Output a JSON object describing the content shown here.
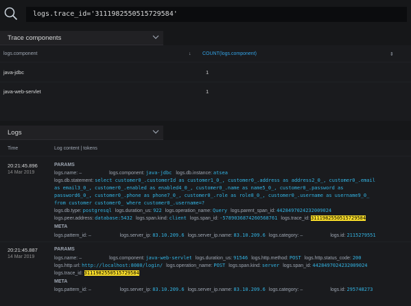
{
  "query": {
    "prefix": "logs.",
    "field": "trace_id",
    "op": "=",
    "value": "'3111982550515729584'"
  },
  "trace_panel": {
    "title": "Trace components",
    "col_component": "logs.component",
    "col_count": "COUNT(logs.component)",
    "rows": [
      {
        "component": "java-jdbc",
        "count": "1"
      },
      {
        "component": "java-web-servlet",
        "count": "1"
      }
    ]
  },
  "logs_panel": {
    "title": "Logs",
    "col_time": "Time",
    "col_content": "Log content | tokens",
    "entries": [
      {
        "time": "20:21:45.896",
        "date": "14 Mar 2019",
        "params_label": "PARAMS",
        "meta_label": "META",
        "l1": {
          "name_k": "logs.name:",
          "name_v": "–",
          "comp_k": "logs.component:",
          "comp_v": "java-jdbc",
          "inst_k": "logs.db.instance:",
          "inst_v": "atsea"
        },
        "l2": {
          "stmt_k": "logs.db.statement:",
          "stmt_v": "select customer0_.customerId as customer1_0_, customer0_.address as address2_0_, customer0_.email"
        },
        "l3": "as email3_0_, customer0_.enabled as enabled4_0_, customer0_.name as name5_0_, customer0_.password as",
        "l4": "password6_0_, customer0_.phone as phone7_0_, customer0_.role as role8_0_, customer0_.username as username9_0_",
        "l5": "from customer customer0_ where customer0_.username=?",
        "l6": {
          "type_k": "logs.db.type:",
          "type_v": "postgresql",
          "dur_k": "logs.duration_us:",
          "dur_v": "922",
          "op_k": "logs.operation_name:",
          "op_v": "Query",
          "parent_k": "logs.parent_span_id:",
          "parent_v": "4428497024232009024"
        },
        "l7": {
          "peer_k": "logs.peer.address:",
          "peer_v": "database:5432",
          "kind_k": "logs.span.kind:",
          "kind_v": "client",
          "span_k": "logs.span_id:",
          "span_v": "-5789036874260568761",
          "trace_k": "logs.trace_id:",
          "trace_v": "3111982550515729584"
        },
        "m1": {
          "pat_k": "logs.pattern_id:",
          "pat_v": "–",
          "ip_k": "logs.server_ip:",
          "ip_v": "83.10.209.6",
          "ipn_k": "logs.server_ip.name:",
          "ipn_v": "83.10.209.6",
          "cat_k": "logs.category:",
          "cat_v": "–",
          "id_k": "logs.id:",
          "id_v": "2115279551"
        }
      },
      {
        "time": "20:21:45.887",
        "date": "14 Mar 2019",
        "params_label": "PARAMS",
        "meta_label": "META",
        "l1": {
          "name_k": "logs.name:",
          "name_v": "–",
          "comp_k": "logs.component:",
          "comp_v": "java-web-servlet",
          "dur_k": "logs.duration_us:",
          "dur_v": "91546",
          "meth_k": "logs.http.method:",
          "meth_v": "POST",
          "code_k": "logs.http.status_code:",
          "code_v": "200"
        },
        "l2": {
          "url_k": "logs.http.url:",
          "url_v": "http://localhost:8080/login/",
          "op_k": "logs.operation_name:",
          "op_v": "POST",
          "kind_k": "logs.span.kind:",
          "kind_v": "server",
          "span_k": "logs.span_id:",
          "span_v": "4428497024232009024"
        },
        "l3": {
          "trace_k": "logs.trace_id:",
          "trace_v": "3111982550515729584"
        },
        "m1": {
          "pat_k": "logs.pattern_id:",
          "pat_v": "–",
          "ip_k": "logs.server_ip:",
          "ip_v": "83.10.209.6",
          "ipn_k": "logs.server_ip.name:",
          "ipn_v": "83.10.209.6",
          "cat_k": "logs.category:",
          "cat_v": "–",
          "id_k": "logs.id:",
          "id_v": "295748273"
        }
      }
    ]
  },
  "colors": {
    "accent": "#33b5e5",
    "highlight": "#fade2a",
    "background": "#161719"
  }
}
